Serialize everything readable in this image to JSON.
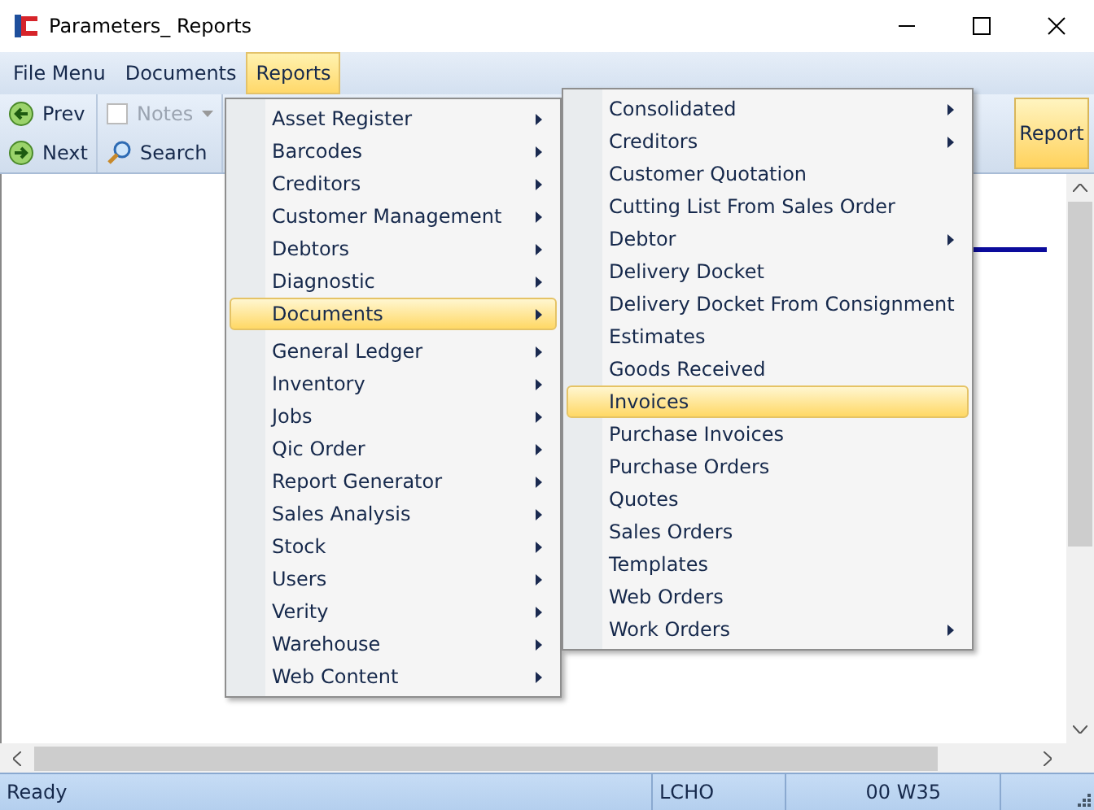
{
  "window": {
    "title": "Parameters_ Reports"
  },
  "menubar": [
    {
      "label": "File Menu",
      "selected": false
    },
    {
      "label": "Documents",
      "selected": false
    },
    {
      "label": "Reports",
      "selected": true
    }
  ],
  "toolbar": {
    "prev": "Prev",
    "next": "Next",
    "notes": {
      "label": "Notes",
      "disabled": true
    },
    "search": "Search",
    "report": "Report"
  },
  "menu": [
    {
      "label": "Asset Register",
      "has_submenu": true,
      "selected": false
    },
    {
      "label": "Barcodes",
      "has_submenu": true,
      "selected": false
    },
    {
      "label": "Creditors",
      "has_submenu": true,
      "selected": false
    },
    {
      "label": "Customer Management",
      "has_submenu": true,
      "selected": false
    },
    {
      "label": "Debtors",
      "has_submenu": true,
      "selected": false
    },
    {
      "label": "Diagnostic",
      "has_submenu": true,
      "selected": false
    },
    {
      "label": "Documents",
      "has_submenu": true,
      "selected": true,
      "separator_after": true
    },
    {
      "label": "General Ledger",
      "has_submenu": true,
      "selected": false
    },
    {
      "label": "Inventory",
      "has_submenu": true,
      "selected": false
    },
    {
      "label": "Jobs",
      "has_submenu": true,
      "selected": false
    },
    {
      "label": "Qic Order",
      "has_submenu": true,
      "selected": false
    },
    {
      "label": "Report Generator",
      "has_submenu": true,
      "selected": false
    },
    {
      "label": "Sales Analysis",
      "has_submenu": true,
      "selected": false
    },
    {
      "label": "Stock",
      "has_submenu": true,
      "selected": false
    },
    {
      "label": "Users",
      "has_submenu": true,
      "selected": false
    },
    {
      "label": "Verity",
      "has_submenu": true,
      "selected": false
    },
    {
      "label": "Warehouse",
      "has_submenu": true,
      "selected": false
    },
    {
      "label": "Web Content",
      "has_submenu": true,
      "selected": false
    }
  ],
  "submenu": [
    {
      "label": "Consolidated",
      "has_submenu": true,
      "selected": false
    },
    {
      "label": "Creditors",
      "has_submenu": true,
      "selected": false
    },
    {
      "label": "Customer Quotation",
      "has_submenu": false,
      "selected": false
    },
    {
      "label": "Cutting List From Sales Order",
      "has_submenu": false,
      "selected": false
    },
    {
      "label": "Debtor",
      "has_submenu": true,
      "selected": false
    },
    {
      "label": "Delivery Docket",
      "has_submenu": false,
      "selected": false
    },
    {
      "label": "Delivery Docket From Consignment",
      "has_submenu": false,
      "selected": false
    },
    {
      "label": "Estimates",
      "has_submenu": false,
      "selected": false
    },
    {
      "label": "Goods Received",
      "has_submenu": false,
      "selected": false
    },
    {
      "label": "Invoices",
      "has_submenu": false,
      "selected": true
    },
    {
      "label": "Purchase Invoices",
      "has_submenu": false,
      "selected": false
    },
    {
      "label": "Purchase Orders",
      "has_submenu": false,
      "selected": false
    },
    {
      "label": "Quotes",
      "has_submenu": false,
      "selected": false
    },
    {
      "label": "Sales Orders",
      "has_submenu": false,
      "selected": false
    },
    {
      "label": "Templates",
      "has_submenu": false,
      "selected": false
    },
    {
      "label": "Web Orders",
      "has_submenu": false,
      "selected": false
    },
    {
      "label": "Work Orders",
      "has_submenu": true,
      "selected": false
    }
  ],
  "status_bar": [
    "Ready",
    "LCHO",
    "00 W35"
  ]
}
